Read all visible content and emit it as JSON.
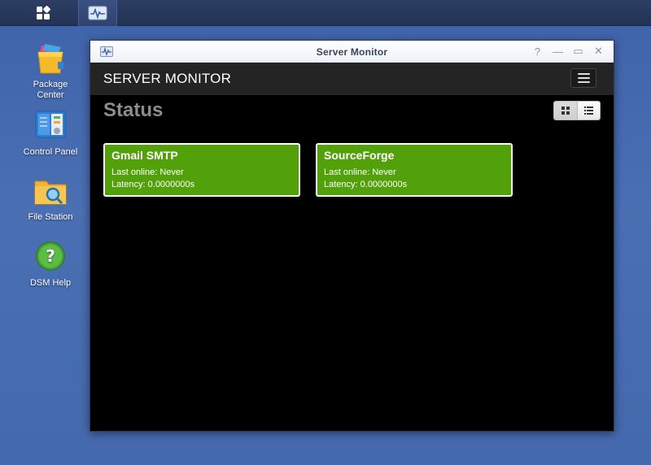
{
  "taskbar": {
    "main_icon": "main-menu-icon",
    "app_icon": "server-monitor-icon"
  },
  "desktop": {
    "icons": [
      {
        "label": "Package\nCenter",
        "icon": "package-center-icon"
      },
      {
        "label": "Control Panel",
        "icon": "control-panel-icon"
      },
      {
        "label": "File Station",
        "icon": "file-station-icon"
      },
      {
        "label": "DSM Help",
        "icon": "dsm-help-icon"
      }
    ]
  },
  "window": {
    "title": "Server Monitor",
    "controls": {
      "help": "?",
      "minimize": "—",
      "maximize": "▭",
      "close": "✕"
    }
  },
  "app": {
    "brand": "SERVER MONITOR",
    "page_title": "Status",
    "view_modes": [
      "grid",
      "list"
    ],
    "active_view": "grid"
  },
  "servers": [
    {
      "name": "Gmail SMTP",
      "last_online": "Last online: Never",
      "latency": "Latency: 0.0000000s"
    },
    {
      "name": "SourceForge",
      "last_online": "Last online: Never",
      "latency": "Latency: 0.0000000s"
    }
  ],
  "colors": {
    "card_green": "#52a10b",
    "desktop_blue": "#4469ad",
    "header_dark": "#242424"
  }
}
